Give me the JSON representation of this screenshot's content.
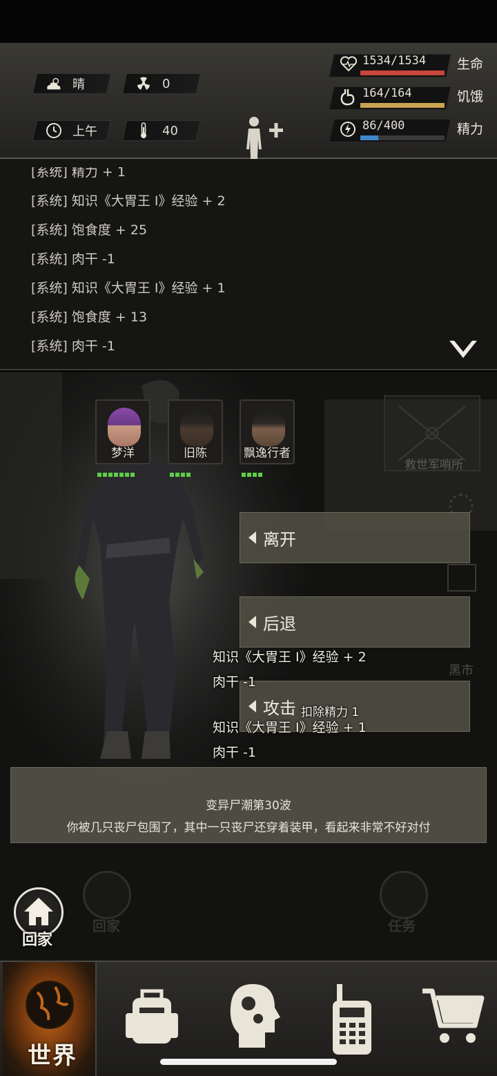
{
  "header": {
    "weather": {
      "icon": "cloud-sun-icon",
      "label": "晴"
    },
    "radiation": {
      "icon": "radiation-icon",
      "value": "0"
    },
    "time": {
      "icon": "clock-icon",
      "label": "上午"
    },
    "temperature": {
      "icon": "thermometer-icon",
      "value": "40"
    },
    "body_status": {
      "icon": "human-body-icon",
      "plus": "+",
      "minus": "−"
    },
    "stats": [
      {
        "icon": "heart-icon",
        "value": "1534/1534",
        "label": "生命",
        "fill": 1.0,
        "color": "#c8463c"
      },
      {
        "icon": "stomach-icon",
        "value": "164/164",
        "label": "饥饿",
        "fill": 1.0,
        "color": "#c9a451"
      },
      {
        "icon": "energy-icon",
        "value": "86/400",
        "label": "精力",
        "fill": 0.215,
        "color": "#3f86c8"
      }
    ]
  },
  "log": {
    "lines": [
      "[系统] 精力 + 1",
      "[系统] 知识《大胃王 I》经验 + 2",
      "[系统] 饱食度 + 25",
      "[系统] 肉干 -1",
      "[系统] 知识《大胃王 I》经验 + 1",
      "[系统] 饱食度 + 13",
      "[系统] 肉干 -1"
    ]
  },
  "scene": {
    "party": [
      {
        "name": "梦洋",
        "hp_pips": 7
      },
      {
        "name": "旧陈",
        "hp_pips": 4
      },
      {
        "name": "飘逸行者",
        "hp_pips": 4
      }
    ],
    "outpost_label": "救世军哨所",
    "ghost_market": "黑市",
    "actions": [
      {
        "label": "离开"
      },
      {
        "label": "后退"
      },
      {
        "label": "攻击"
      }
    ],
    "floating_texts": [
      "知识《大胃王 I》经验 + 2",
      "肉干 -1",
      "扣除精力 1",
      "知识《大胃王 I》经验 + 1",
      "肉干 -1"
    ],
    "event": {
      "title": "变异尸潮第30波",
      "description": "你被几只丧尸包围了，其中一只丧尸还穿着装甲，看起来非常不好对付"
    },
    "ghost_buttons": [
      {
        "label": "回家"
      },
      {
        "label": "任务"
      }
    ],
    "home_button": {
      "label": "回家"
    }
  },
  "bottom_nav": {
    "items": [
      {
        "label": "世界",
        "icon": "globe-icon"
      },
      {
        "label": "",
        "icon": "backpack-icon"
      },
      {
        "label": "",
        "icon": "head-gears-icon"
      },
      {
        "label": "",
        "icon": "walkie-talkie-icon"
      },
      {
        "label": "",
        "icon": "shopping-cart-icon"
      }
    ]
  },
  "colors": {
    "hp": "#c8463c",
    "hunger": "#c9a451",
    "energy": "#3f86c8",
    "pips": "#5fcf4a",
    "world_glow": "#c0671c"
  }
}
